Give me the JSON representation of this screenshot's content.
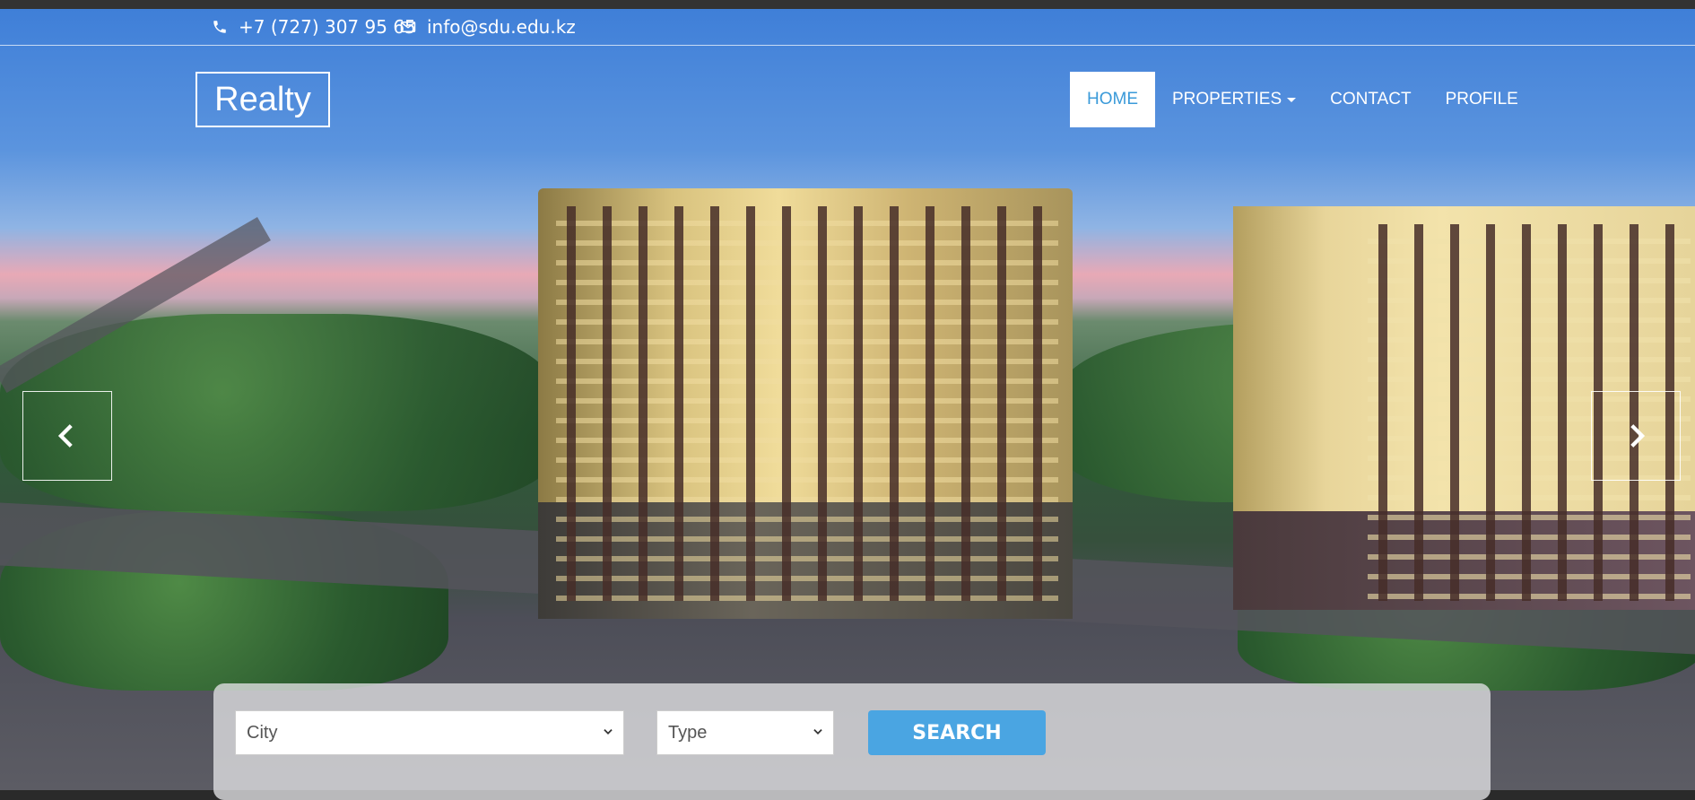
{
  "contact": {
    "phone": "+7 (727) 307 95 65",
    "email": "info@sdu.edu.kz"
  },
  "brand": {
    "logo_text": "Realty"
  },
  "nav": {
    "items": [
      {
        "label": "HOME",
        "active": true
      },
      {
        "label": "PROPERTIES",
        "has_dropdown": true
      },
      {
        "label": "CONTACT"
      },
      {
        "label": "PROFILE"
      }
    ]
  },
  "carousel": {
    "prev_icon": "chevron-left-icon",
    "next_icon": "chevron-right-icon"
  },
  "search": {
    "city_value": "City",
    "type_value": "Type",
    "button_label": "SEARCH"
  },
  "colors": {
    "accent": "#4aa5e2",
    "active_nav_text": "#3a9ad9",
    "header_bar": "#333333"
  }
}
